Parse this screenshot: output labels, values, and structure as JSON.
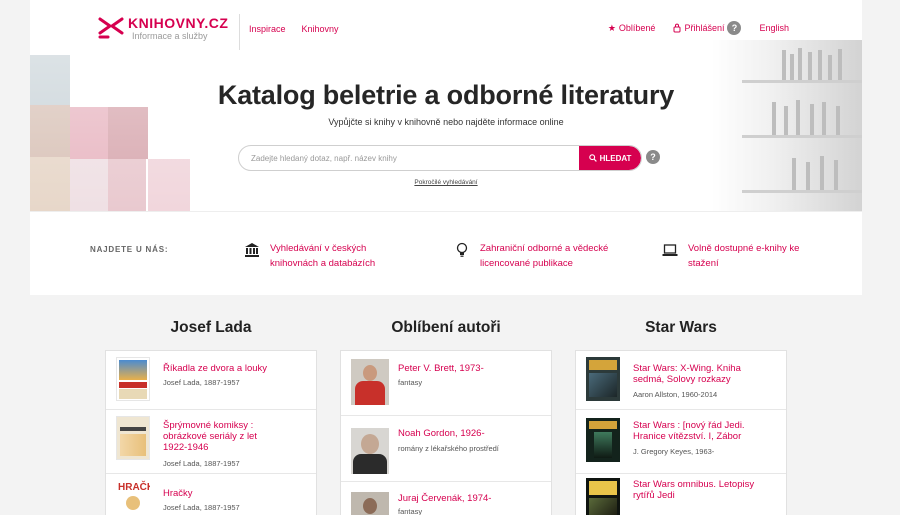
{
  "header": {
    "logo_title": "KNIHOVNY.CZ",
    "logo_subtitle": "Informace a služby",
    "nav_left": [
      "Inspirace",
      "Knihovny"
    ],
    "favorites": "Oblíbené",
    "login": "Přihlášení",
    "help": "?",
    "language": "English"
  },
  "hero": {
    "title": "Katalog beletrie a odborné literatury",
    "subtitle": "Vypůjčte si knihy v knihovně nebo najděte informace online",
    "search_placeholder": "Zadejte hledaný dotaz, např. název knihy",
    "search_button": "HLEDAT",
    "advanced": "Pokročilé vyhledávání"
  },
  "find": {
    "label": "NAJDETE U NÁS:",
    "items": [
      {
        "text_line1": "Vyhledávání v českých",
        "text_line2": "knihovnách a databázích",
        "icon": "library-icon"
      },
      {
        "text_line1": "Zahraniční odborné a vědecké",
        "text_line2": "licencované publikace",
        "icon": "lightbulb-icon"
      },
      {
        "text_line1": "Volně dostupné e-knihy ke",
        "text_line2": "stažení",
        "icon": "laptop-icon"
      }
    ]
  },
  "columns": [
    {
      "title": "Josef Lada",
      "rows": [
        {
          "title": [
            "Říkadla ze dvora a louky"
          ],
          "sub": "Josef Lada, 1887-1957"
        },
        {
          "title": [
            "Šprýmovné komiksy :",
            "obrázkové seriály z let",
            "1922-1946"
          ],
          "sub": "Josef Lada, 1887-1957"
        },
        {
          "title": [
            "Hračky"
          ],
          "sub": "Josef Lada, 1887-1957"
        }
      ]
    },
    {
      "title": "Oblíbení autoři",
      "rows": [
        {
          "title": [
            "Peter V. Brett, 1973-"
          ],
          "sub": "fantasy"
        },
        {
          "title": [
            "Noah Gordon, 1926-"
          ],
          "sub": "romány z lékařského prostředí"
        },
        {
          "title": [
            "Juraj Červenák, 1974-"
          ],
          "sub": "fantasy"
        }
      ]
    },
    {
      "title": "Star Wars",
      "rows": [
        {
          "title": [
            "Star Wars: X-Wing. Kniha",
            "sedmá, Solovy rozkazy"
          ],
          "sub": "Aaron Allston, 1960-2014"
        },
        {
          "title": [
            "Star Wars : [nový řád Jedi.",
            "Hranice vítězství. I, Zábor"
          ],
          "sub": "J. Gregory Keyes, 1963-"
        },
        {
          "title": [
            "Star Wars omnibus. Letopisy",
            "rytířů Jedi"
          ],
          "sub": ""
        }
      ]
    }
  ],
  "colors": {
    "accent": "#d6004f",
    "background": "#f3f3f3",
    "help_grey": "#8a8a8a"
  }
}
